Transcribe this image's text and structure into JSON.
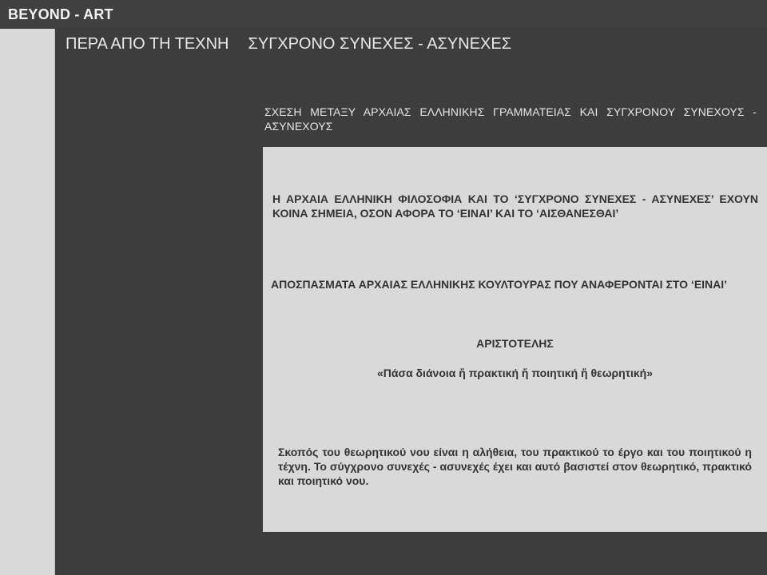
{
  "site": {
    "title": "BEYOND - ART"
  },
  "nav": {
    "items": [
      {
        "label": "ΠΕΡΑ ΑΠΟ ΤΗ ΤΕΧΝΗ"
      },
      {
        "label": "ΣΥΓΧΡΟΝΟ ΣΥΝΕΧΕΣ - ΑΣΥΝΕΧΕΣ"
      }
    ]
  },
  "main": {
    "heading": "ΣΧΕΣΗ ΜΕΤΑΞΥ ΑΡΧΑΙΑΣ ΕΛΛΗΝΙΚΗΣ ΓΡΑΜΜΑΤΕΙΑΣ ΚΑΙ ΣΥΓΧΡΟΝΟΥ ΣΥΝΕΧΟΥΣ - ΑΣΥΝΕΧΟΥΣ",
    "panel": {
      "intro": "Η ΑΡΧΑΙΑ ΕΛΛΗΝΙΚΗ ΦΙΛΟΣΟΦΙΑ ΚΑΙ ΤΟ ‘ΣΥΓΧΡΟΝΟ ΣΥΝΕΧΕΣ - ΑΣΥΝΕΧΕΣ’ ΕΧΟΥΝ ΚΟΙΝΑ ΣΗΜΕΙΑ, ΟΣΟΝ ΑΦΟΡΑ ΤΟ ‘ΕΙΝΑΙ’ ΚΑΙ ΤΟ ‘ΑΙΣΘΑΝΕΣΘΑΙ’",
      "excerpts_heading": "ΑΠΟΣΠΑΣΜΑΤΑ ΑΡΧΑΙΑΣ ΕΛΛΗΝΙΚΗΣ ΚΟΥΛΤΟΥΡΑΣ ΠΟΥ ΑΝΑΦΕΡΟΝΤΑΙ ΣΤΟ ‘ΕΙΝΑΙ’",
      "author": "ΑΡΙΣΤΟΤΕΛΗΣ",
      "quote": "«Πάσα διάνοια ἤ πρακτική ἤ ποιητική ἤ θεωρητική»",
      "commentary": "Σκοπός του θεωρητικού νου είναι η αλήθεια, του πρακτικού το έργο και του ποιητικού η τέχνη. Το σύγχρονο συνεχές - ασυνεχές έχει και αυτό βασιστεί στον θεωρητικό, πρακτικό και ποιητικό νου."
    }
  },
  "colors": {
    "background": "#3d3d3d",
    "panel": "#d9d9d9",
    "panel_text": "#333333",
    "header_text": "#f2f2f2"
  }
}
